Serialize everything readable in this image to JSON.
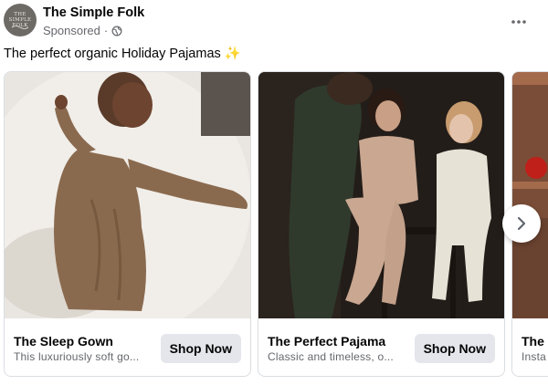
{
  "post": {
    "page_name": "The Simple Folk",
    "sponsored": "Sponsored",
    "separator": "·",
    "avatar_text_line1": "THE",
    "avatar_text_line2": "SIMPLE FOLK",
    "caption": "The perfect organic Holiday Pajamas",
    "caption_emoji": "✨",
    "more_icon": "more-options-icon",
    "privacy_icon": "globe-icon"
  },
  "cards": [
    {
      "title": "The Sleep Gown",
      "description": "This luxuriously soft go...",
      "cta": "Shop Now"
    },
    {
      "title": "The Perfect Pajama",
      "description": "Classic and timeless, o...",
      "cta": "Shop Now"
    },
    {
      "title": "The",
      "description": "Insta",
      "cta": ""
    }
  ],
  "colors": {
    "secondary_text": "#65676b",
    "button_bg": "#e4e6eb",
    "card_border": "#dadde1"
  }
}
